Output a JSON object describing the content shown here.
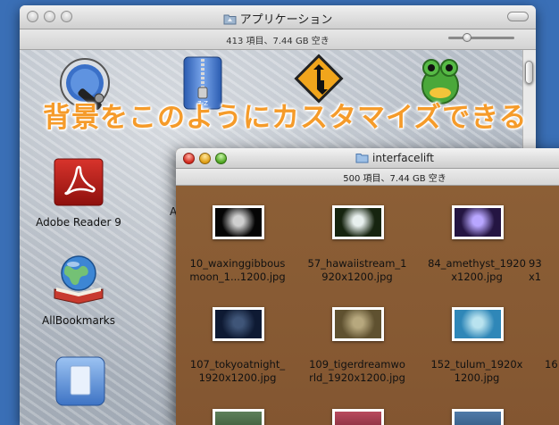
{
  "windows": {
    "back": {
      "title": "アプリケーション",
      "status": "413 項目、7.44 GB 空き",
      "apps": [
        {
          "name": "",
          "icon": "system-preferences-tool-icon"
        },
        {
          "name": "",
          "icon": "archive-zip-icon",
          "badge": "7-Z"
        },
        {
          "name": "",
          "icon": "road-sign-icon"
        },
        {
          "name": "",
          "icon": "green-frog-icon"
        },
        {
          "name": "Adobe Reader 9",
          "icon": "adobe-reader-icon"
        },
        {
          "name": "AllBookmarks",
          "icon": "globe-book-icon"
        },
        {
          "name": "",
          "icon": "blue-document-icon"
        }
      ],
      "partial_label": "A"
    },
    "front": {
      "title": "interfacelift",
      "status": "500 項目、7.44 GB 空き",
      "files": [
        {
          "line1": "10_waxinggibbous",
          "line2": "moon_1...1200.jpg",
          "colors": [
            "#050505",
            "#cfcfcf"
          ]
        },
        {
          "line1": "57_hawaiistream_1",
          "line2": "920x1200.jpg",
          "colors": [
            "#16240f",
            "#e8f0ee"
          ]
        },
        {
          "line1": "84_amethyst_1920",
          "line2": "x1200.jpg",
          "colors": [
            "#241542",
            "#b8a6ff"
          ]
        },
        {
          "line1": "93",
          "line2": "x1",
          "colors": [
            "#2a2a2a",
            "#999999"
          ]
        },
        {
          "line1": "107_tokyoatnight_",
          "line2": "1920x1200.jpg",
          "colors": [
            "#0e1a33",
            "#3f5578"
          ]
        },
        {
          "line1": "109_tigerdreamwo",
          "line2": "rld_1920x1200.jpg",
          "colors": [
            "#5f5130",
            "#b7a87e"
          ]
        },
        {
          "line1": "152_tulum_1920x",
          "line2": "1200.jpg",
          "colors": [
            "#2f87b8",
            "#b9e3ef"
          ]
        },
        {
          "line1": "16",
          "line2": "",
          "colors": [
            "#333333",
            "#777777"
          ]
        }
      ]
    }
  },
  "caption": "背景をこのようにカスタマイズできる"
}
